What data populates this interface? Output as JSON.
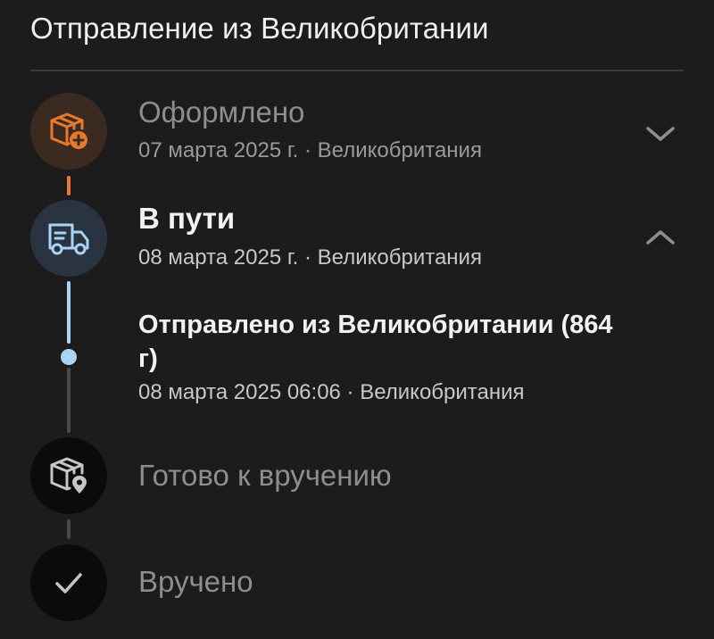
{
  "header": {
    "title": "Отправление из Великобритании"
  },
  "colors": {
    "accent_orange": "#e8792c",
    "accent_blue": "#a9d4f5",
    "background": "#1c1c1c"
  },
  "timeline": [
    {
      "icon": "box-plus-icon",
      "status": "Оформлено",
      "meta": "07 марта 2025 г. · Великобритания",
      "state": "done",
      "expanded": false
    },
    {
      "icon": "truck-icon",
      "status": "В пути",
      "meta": "08 марта 2025 г. · Великобритания",
      "state": "current",
      "expanded": true,
      "events": [
        {
          "title": "Отправлено из Великобритании (864 г)",
          "meta": "08 марта 2025 06:06 · Великобритания"
        }
      ]
    },
    {
      "icon": "box-location-icon",
      "status": "Готово к вручению",
      "state": "pending"
    },
    {
      "icon": "checkmark-icon",
      "status": "Вручено",
      "state": "pending"
    }
  ]
}
